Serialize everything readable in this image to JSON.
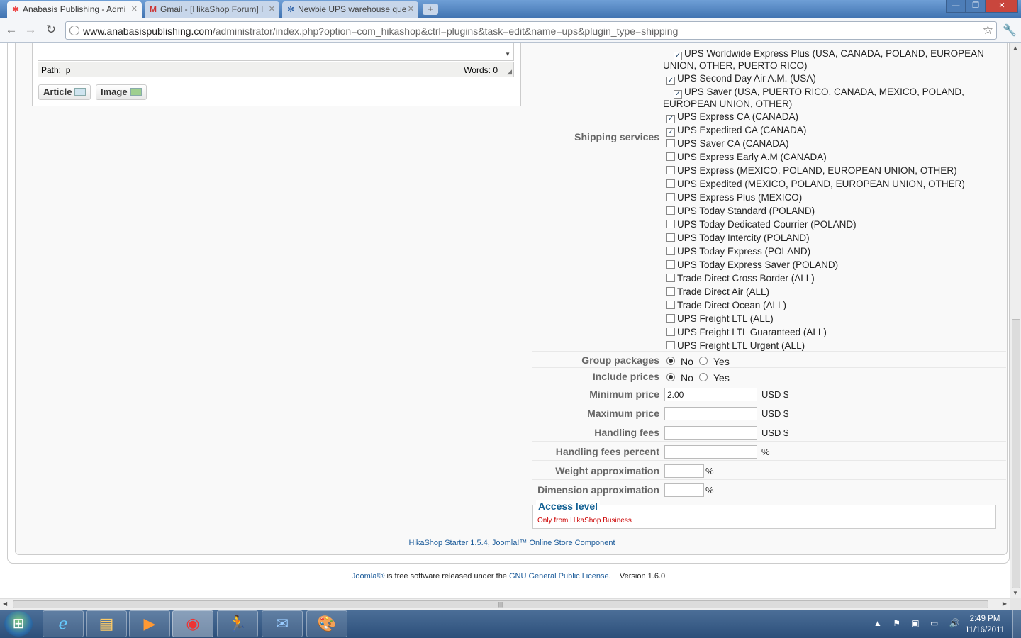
{
  "browser": {
    "tabs": [
      {
        "title": "Anabasis Publishing - Admi",
        "favicon": "joomla-icon",
        "active": true
      },
      {
        "title": "Gmail - [HikaShop Forum] I",
        "favicon": "gmail-icon",
        "active": false
      },
      {
        "title": "Newbie UPS warehouse que",
        "favicon": "forum-icon",
        "active": false
      }
    ],
    "url_host": "www.anabasispublishing.com",
    "url_path": "/administrator/index.php?option=com_hikashop&ctrl=plugins&task=edit&name=ups&plugin_type=shipping"
  },
  "editor": {
    "path_label": "Path:",
    "path_value": "p",
    "words_label": "Words:",
    "words_value": "0",
    "buttons": [
      "Article",
      "Image"
    ]
  },
  "shipping_services": {
    "label": "Shipping services",
    "items": [
      {
        "name": "UPS Worldwide Express Plus (USA, CANADA, POLAND, EUROPEAN UNION, OTHER, PUERTO RICO)",
        "checked": true
      },
      {
        "name": "UPS Second Day Air A.M. (USA)",
        "checked": true
      },
      {
        "name": "UPS Saver (USA, PUERTO RICO, CANADA, MEXICO, POLAND, EUROPEAN UNION, OTHER)",
        "checked": true
      },
      {
        "name": "UPS Express CA (CANADA)",
        "checked": true
      },
      {
        "name": "UPS Expedited CA (CANADA)",
        "checked": true
      },
      {
        "name": "UPS Saver CA (CANADA)",
        "checked": false
      },
      {
        "name": "UPS Express Early A.M (CANADA)",
        "checked": false
      },
      {
        "name": "UPS Express (MEXICO, POLAND, EUROPEAN UNION, OTHER)",
        "checked": false
      },
      {
        "name": "UPS Expedited (MEXICO, POLAND, EUROPEAN UNION, OTHER)",
        "checked": false
      },
      {
        "name": "UPS Express Plus (MEXICO)",
        "checked": false
      },
      {
        "name": "UPS Today Standard (POLAND)",
        "checked": false
      },
      {
        "name": "UPS Today Dedicated Courrier (POLAND)",
        "checked": false
      },
      {
        "name": "UPS Today Intercity (POLAND)",
        "checked": false
      },
      {
        "name": "UPS Today Express (POLAND)",
        "checked": false
      },
      {
        "name": "UPS Today Express Saver (POLAND)",
        "checked": false
      },
      {
        "name": "Trade Direct Cross Border (ALL)",
        "checked": false
      },
      {
        "name": "Trade Direct Air (ALL)",
        "checked": false
      },
      {
        "name": "Trade Direct Ocean (ALL)",
        "checked": false
      },
      {
        "name": "UPS Freight LTL (ALL)",
        "checked": false
      },
      {
        "name": "UPS Freight LTL Guaranteed (ALL)",
        "checked": false
      },
      {
        "name": "UPS Freight LTL Urgent (ALL)",
        "checked": false
      }
    ]
  },
  "group_packages": {
    "label": "Group packages",
    "no": "No",
    "yes": "Yes",
    "selected": "No"
  },
  "include_prices": {
    "label": "Include prices",
    "no": "No",
    "yes": "Yes",
    "selected": "No"
  },
  "minimum_price": {
    "label": "Minimum price",
    "value": "2.00",
    "unit": "USD $"
  },
  "maximum_price": {
    "label": "Maximum price",
    "value": "",
    "unit": "USD $"
  },
  "handling_fees": {
    "label": "Handling fees",
    "value": "",
    "unit": "USD $"
  },
  "handling_fees_percent": {
    "label": "Handling fees percent",
    "value": "",
    "unit": "%"
  },
  "weight_approximation": {
    "label": "Weight approximation",
    "value": "",
    "unit": "%"
  },
  "dimension_approximation": {
    "label": "Dimension approximation",
    "value": "",
    "unit": "%"
  },
  "access_level": {
    "legend": "Access level",
    "note": "Only from HikaShop Business"
  },
  "credit": "HikaShop Starter 1.5.4, Joomla!™ Online Store Component",
  "footer": {
    "joomla_link": "Joomla!®",
    "text1": " is free software released under the ",
    "gpl_link": "GNU General Public License.",
    "version": "Version 1.6.0"
  },
  "taskbar": {
    "apps": [
      "internet-explorer-icon",
      "file-explorer-icon",
      "media-player-icon",
      "chrome-icon",
      "aim-icon",
      "thunderbird-icon",
      "paint-icon"
    ],
    "time": "2:49 PM",
    "date": "11/16/2011"
  }
}
